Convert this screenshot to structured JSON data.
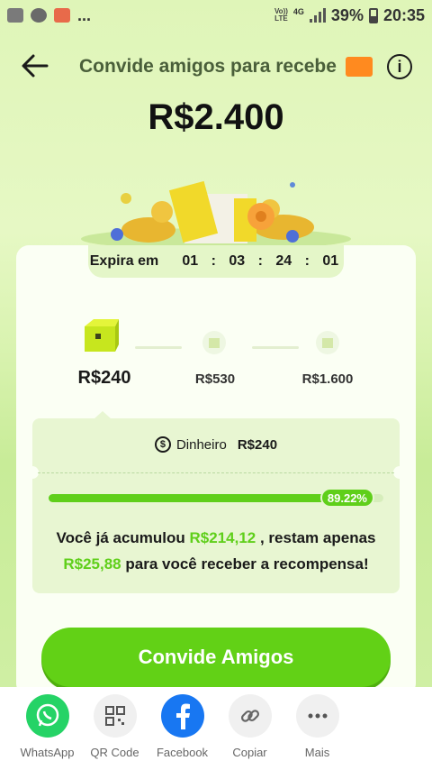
{
  "status_bar": {
    "carrier_lines": [
      "Vo))",
      "LTE"
    ],
    "network": "4G",
    "battery": "39%",
    "time": "20:35",
    "ellipsis": "..."
  },
  "header": {
    "title": "Convide amigos para recebe",
    "back_icon": "arrow-left-icon",
    "info_icon": "info-icon",
    "info_glyph": "i"
  },
  "reward_amount": "R$2.400",
  "expiry": {
    "label": "Expira em",
    "days": "01",
    "hours": "03",
    "minutes": "24",
    "seconds": "01",
    "separator": ":"
  },
  "steps": [
    {
      "label": "R$240",
      "icon": "gift-box-icon",
      "active": true
    },
    {
      "label": "R$530",
      "icon": "locked-gift-icon",
      "active": false
    },
    {
      "label": "R$1.600",
      "icon": "locked-gift-icon",
      "active": false
    }
  ],
  "panel": {
    "money_icon_glyph": "$",
    "money_label": "Dinheiro",
    "money_value": "R$240",
    "progress_fraction": 0.8922,
    "progress_text": "89.22%",
    "message_part1": "Você já acumulou ",
    "accumulated": "R$214,12",
    "message_part2": " , restam apenas ",
    "remaining": "R$25,88",
    "message_part3": " para você receber a recompensa!"
  },
  "cta_label": "Convide Amigos",
  "share": [
    {
      "label": "WhatsApp",
      "icon": "whatsapp-icon",
      "color": "#25d366"
    },
    {
      "label": "QR Code",
      "icon": "qr-code-icon",
      "color": "#f0f0f0"
    },
    {
      "label": "Facebook",
      "icon": "facebook-icon",
      "color": "#1877f2"
    },
    {
      "label": "Copiar",
      "icon": "link-icon",
      "color": "#f0f0f0"
    },
    {
      "label": "Mais",
      "icon": "more-dots-icon",
      "color": "#f0f0f0"
    }
  ],
  "colors": {
    "accent_green": "#5fcf1a",
    "cta_green": "#62d116",
    "badge_orange": "#ff8a1f"
  }
}
